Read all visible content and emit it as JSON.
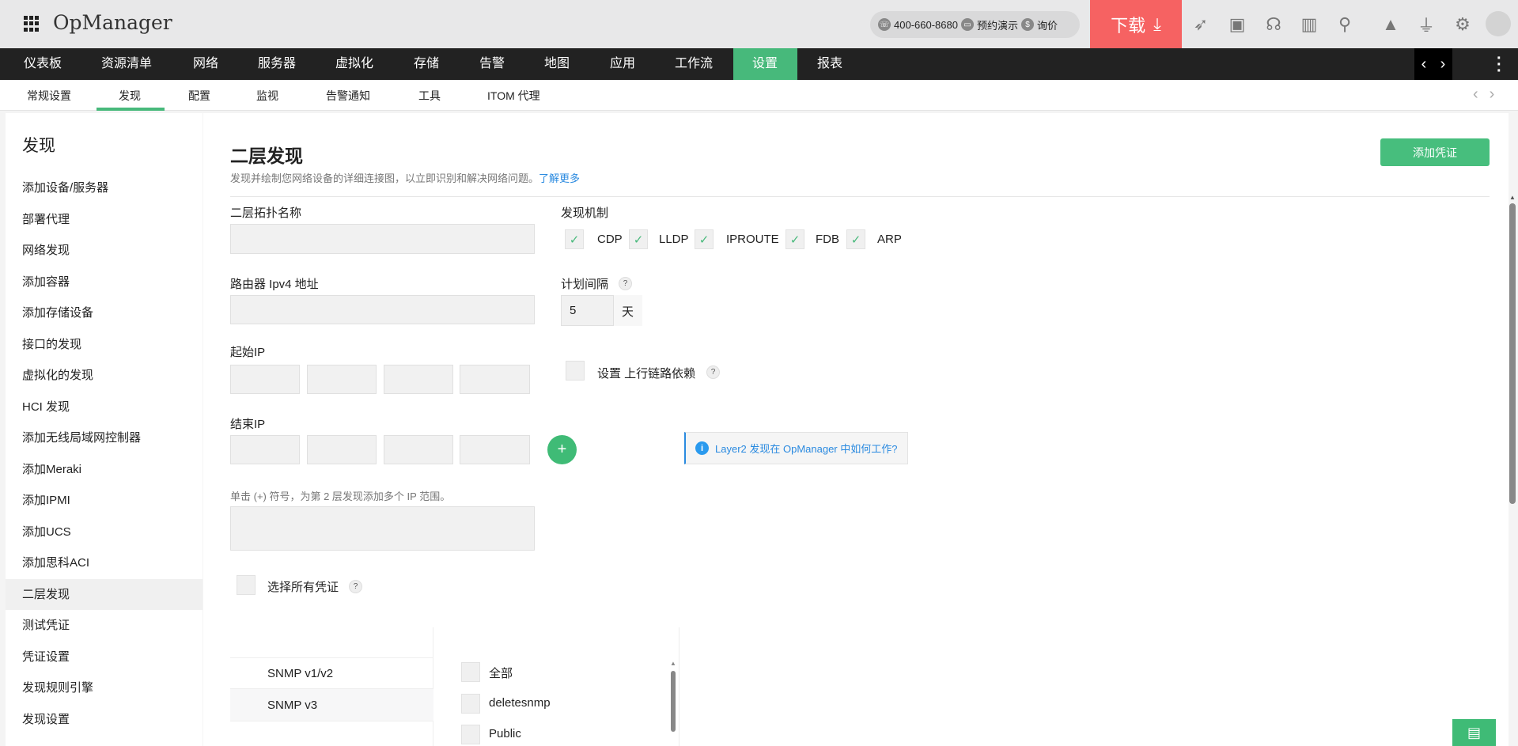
{
  "app": {
    "title": "OpManager",
    "phone": "400-660-8680",
    "demo": "预约演示",
    "price": "询价",
    "download": "下载"
  },
  "topnav": [
    "仪表板",
    "资源清单",
    "网络",
    "服务器",
    "虚拟化",
    "存储",
    "告警",
    "地图",
    "应用",
    "工作流",
    "设置",
    "报表"
  ],
  "subnav": [
    "常规设置",
    "发现",
    "配置",
    "监视",
    "告警通知",
    "工具",
    "ITOM 代理"
  ],
  "sidebar": {
    "title": "发现",
    "items": [
      "添加设备/服务器",
      "部署代理",
      "网络发现",
      "添加容器",
      "添加存储设备",
      "接口的发现",
      "虚拟化的发现",
      "HCI 发现",
      "添加无线局域网控制器",
      "添加Meraki",
      "添加IPMI",
      "添加UCS",
      "添加思科ACI",
      "二层发现",
      "测试凭证",
      "凭证设置",
      "发现规则引擎",
      "发现设置"
    ],
    "active": "二层发现"
  },
  "main": {
    "title": "二层发现",
    "desc": "发现并绘制您网络设备的详细连接图，以立即识别和解决网络问题。",
    "learn_more": "了解更多",
    "add_credential": "添加凭证",
    "topology_name_label": "二层拓扑名称",
    "router_label": "路由器 Ipv4 地址",
    "start_ip_label": "起始IP",
    "end_ip_label": "结束IP",
    "mechanism_label": "发现机制",
    "mechanisms": [
      {
        "label": "CDP",
        "checked": true
      },
      {
        "label": "LLDP",
        "checked": true
      },
      {
        "label": "IPROUTE",
        "checked": true
      },
      {
        "label": "FDB",
        "checked": true
      },
      {
        "label": "ARP",
        "checked": true
      }
    ],
    "schedule_label": "计划间隔",
    "schedule_value": "5",
    "schedule_unit": "天",
    "uplink_label": "设置 上行链路依赖",
    "info_link": "Layer2 发现在 OpManager 中如何工作?",
    "hint": "单击 (+) 符号，为第 2 层发现添加多个 IP 范围。",
    "select_all_label": "选择所有凭证",
    "cred_types": [
      "SNMP v1/v2",
      "SNMP v3"
    ],
    "credentials": [
      "全部",
      "deletesnmp",
      "Public"
    ]
  },
  "check_mark": "✓",
  "help_mark": "?",
  "plus_mark": "+",
  "colors": {
    "accent": "#47b97b",
    "download": "#f66262",
    "link": "#2a8ae0"
  }
}
